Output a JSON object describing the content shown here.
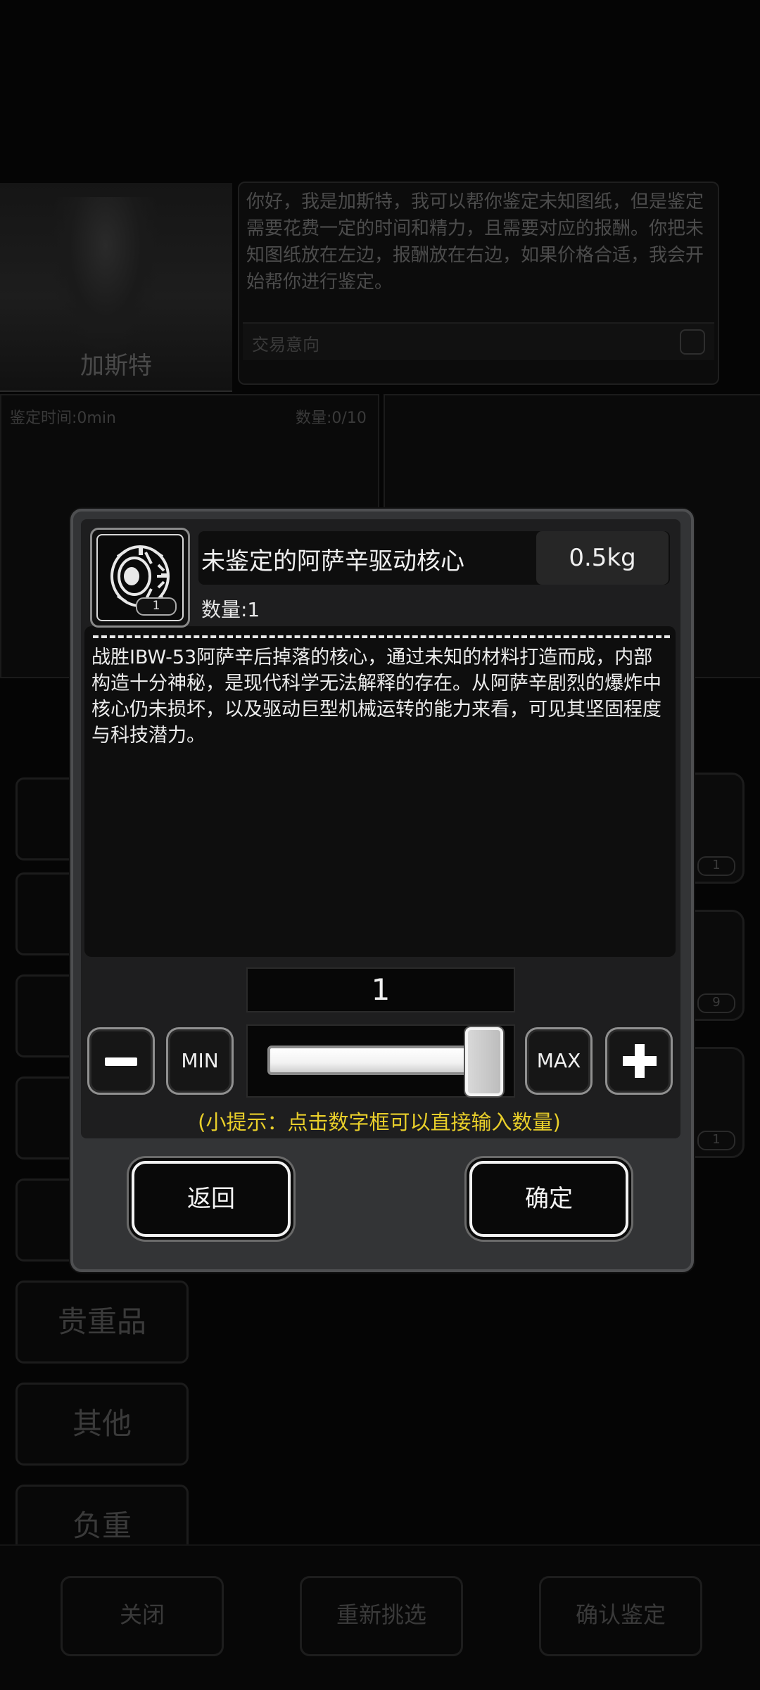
{
  "background": {
    "npc": {
      "name": "加斯特",
      "dialog": "你好，我是加斯特，我可以帮你鉴定未知图纸，但是鉴定需要花费一定的时间和精力，且需要对应的报酬。你把未知图纸放在左边，报酬放在右边，如果价格合适，我会开始帮你进行鉴定。",
      "trade_label": "交易意向",
      "trade_icon": "face-icon"
    },
    "appraise_panel": {
      "time_label": "鉴定时间:0min",
      "count_label": "数量:0/10"
    },
    "categories": [
      "",
      "",
      "",
      "",
      "",
      "贵重品",
      "其他",
      "负重"
    ],
    "slots": [
      {
        "icon": "wrench-icon",
        "count": "1"
      },
      {
        "icon": "helmet-icon",
        "count": "9"
      },
      {
        "icon": "core-icon",
        "count": "1"
      }
    ],
    "bottom_buttons": {
      "close": "关闭",
      "reselect": "重新挑选",
      "confirm_appraise": "确认鉴定"
    }
  },
  "modal": {
    "item": {
      "icon": "drive-core-icon",
      "icon_count": "1",
      "name": "未鉴定的阿萨辛驱动核心",
      "weight": "0.5kg",
      "quantity_label": "数量:1",
      "description": "战胜IBW-53阿萨辛后掉落的核心，通过未知的材料打造而成，内部构造十分神秘，是现代科学无法解释的存在。从阿萨辛剧烈的爆炸中核心仍未损坏，以及驱动巨型机械运转的能力来看，可见其坚固程度与科技潜力。"
    },
    "selector": {
      "value": "1",
      "min_label": "MIN",
      "max_label": "MAX",
      "slider_fraction": 1.0,
      "hint": "(小提示：点击数字框可以直接输入数量)"
    },
    "buttons": {
      "back": "返回",
      "confirm": "确定"
    }
  }
}
